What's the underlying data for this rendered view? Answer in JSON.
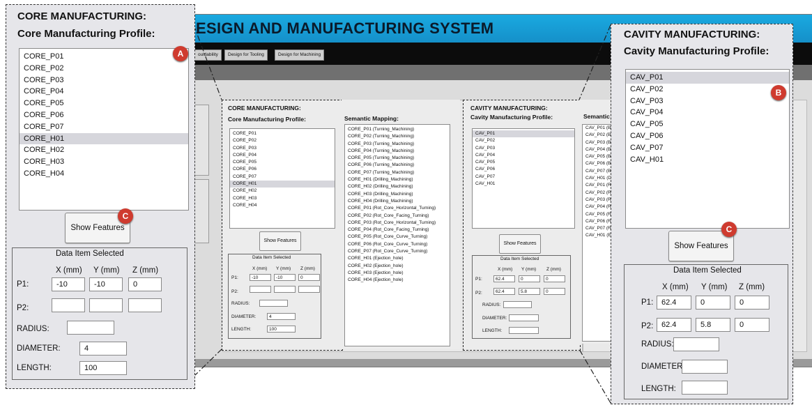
{
  "app": {
    "title": "ESIGN AND MANUFACTURING SYSTEM",
    "nav": [
      "ouldability",
      "Design for Tooling",
      "Design for Machining"
    ]
  },
  "core": {
    "heading": "CORE MANUFACTURING:",
    "profile_label": "Core Manufacturing Profile:",
    "items": [
      "CORE_P01",
      "CORE_P02",
      "CORE_P03",
      "CORE_P04",
      "CORE_P05",
      "CORE_P06",
      "CORE_P07",
      "CORE_H01",
      "CORE_H02",
      "CORE_H03",
      "CORE_H04"
    ],
    "selected": "CORE_H01",
    "show_features": "Show Features",
    "data_title": "Data Item Selected",
    "col_x": "X (mm)",
    "col_y": "Y (mm)",
    "col_z": "Z (mm)",
    "p1_label": "P1:",
    "p2_label": "P2:",
    "radius_label": "RADIUS:",
    "diameter_label": "DIAMETER:",
    "length_label": "LENGTH:",
    "p1": [
      "-10",
      "-10",
      "0"
    ],
    "p2": [
      "",
      "",
      ""
    ],
    "radius": "",
    "diameter": "4",
    "length": "100"
  },
  "semantic_core": {
    "heading": "Semantic Mapping:",
    "items": [
      "CORE_P01 (Turning_Machining)",
      "CORE_P02 (Turning_Machining)",
      "CORE_P03 (Turning_Machining)",
      "CORE_P04 (Turning_Machining)",
      "CORE_P05 (Turning_Machining)",
      "CORE_P06 (Turning_Machining)",
      "CORE_P07 (Turning_Machining)",
      "CORE_H01 (Drilling_Machining)",
      "CORE_H02 (Drilling_Machining)",
      "CORE_H03 (Drilling_Machining)",
      "CORE_H04 (Drilling_Machining)",
      "CORE_P01 (Rot_Core_Horizontal_Turning)",
      "CORE_P02 (Rot_Core_Facing_Turning)",
      "CORE_P03 (Rot_Core_Horizontal_Turning)",
      "CORE_P04 (Rot_Core_Facing_Turning)",
      "CORE_P05 (Rot_Core_Curve_Turning)",
      "CORE_P06 (Rot_Core_Curve_Turning)",
      "CORE_P07 (Rot_Core_Curve_Turning)",
      "CORE_H01 (Ejection_hole)",
      "CORE_H02 (Ejection_hole)",
      "CORE_H03 (Ejection_hole)",
      "CORE_H04 (Ejection_hole)"
    ]
  },
  "cavity": {
    "heading": "CAVITY MANUFACTURING:",
    "profile_label": "Cavity Manufacturing Profile:",
    "items": [
      "CAV_P01",
      "CAV_P02",
      "CAV_P03",
      "CAV_P04",
      "CAV_P05",
      "CAV_P06",
      "CAV_P07",
      "CAV_H01"
    ],
    "selected": "CAV_P01",
    "show_features": "Show Features",
    "data_title": "Data Item Selected",
    "col_x": "X (mm)",
    "col_y": "Y (mm)",
    "col_z": "Z (mm)",
    "p1_label": "P1:",
    "p2_label": "P2:",
    "radius_label": "RADIUS:",
    "diameter_label": "DIAMETER:",
    "length_label": "LENGTH:",
    "p1": [
      "62.4",
      "0",
      "0"
    ],
    "p2": [
      "62.4",
      "5.8",
      "0"
    ],
    "radius": "",
    "diameter": "",
    "length": ""
  },
  "semantic_cavity": {
    "heading": "Semantic",
    "items": [
      "CAV_P01 (Bo",
      "CAV_P02 (Bo",
      "CAV_P03 (Bo",
      "CAV_P04 (Bo",
      "CAV_P05 (Bo",
      "CAV_P06 (Bo",
      "CAV_P07 (Bo",
      "CAV_H01 (Dr",
      "CAV_P01 (Ro",
      "CAV_P02 (Ro",
      "CAV_P03 (Ro",
      "CAV_P04 (Ro",
      "CAV_P05 (Ro",
      "CAV_P06 (Ro",
      "CAV_P07 (Ro",
      "CAV_H01 (Ej"
    ]
  },
  "markers": {
    "a": "A",
    "b": "B",
    "c": "C"
  },
  "colors": {
    "title_bar": "#1a9fd8",
    "marker": "#cf3b2f",
    "nav_bar": "#0c0c0c"
  }
}
